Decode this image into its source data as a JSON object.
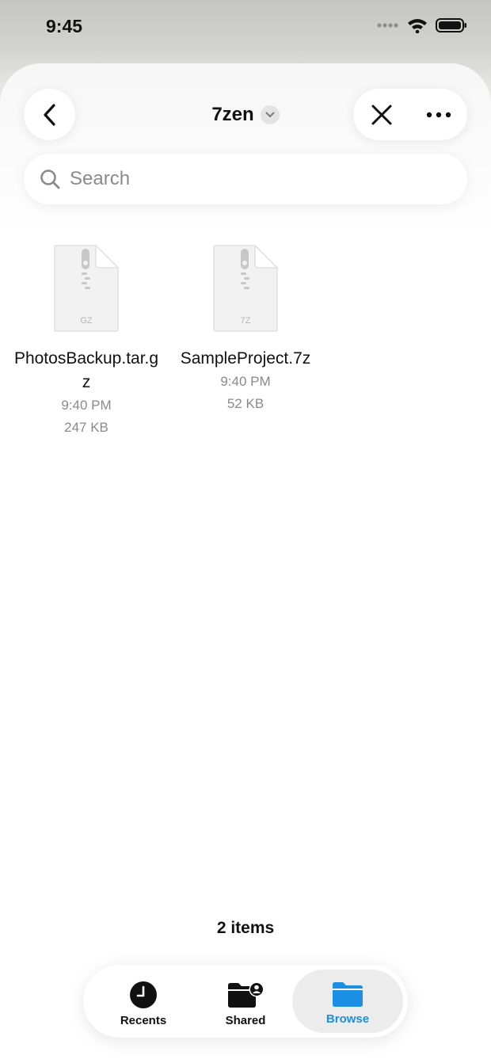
{
  "status_bar": {
    "time": "9:45"
  },
  "header": {
    "title": "7zen"
  },
  "search": {
    "placeholder": "Search"
  },
  "files": [
    {
      "name": "PhotosBackup.tar.gz",
      "type_label": "GZ",
      "time": "9:40 PM",
      "size": "247 KB"
    },
    {
      "name": "SampleProject.7z",
      "type_label": "7Z",
      "time": "9:40 PM",
      "size": "52 KB"
    }
  ],
  "footer": {
    "items_count": "2 items"
  },
  "tabbar": {
    "recents": "Recents",
    "shared": "Shared",
    "browse": "Browse",
    "active": "browse"
  },
  "colors": {
    "accent": "#1a8fe3",
    "secondary_text": "#8a8a8e"
  },
  "icons": {
    "back": "chevron-left-icon",
    "close": "close-icon",
    "more": "ellipsis-icon",
    "search": "search-icon",
    "file": "zip-file-icon",
    "recents": "clock-icon",
    "shared": "shared-folder-icon",
    "browse": "folder-icon"
  }
}
